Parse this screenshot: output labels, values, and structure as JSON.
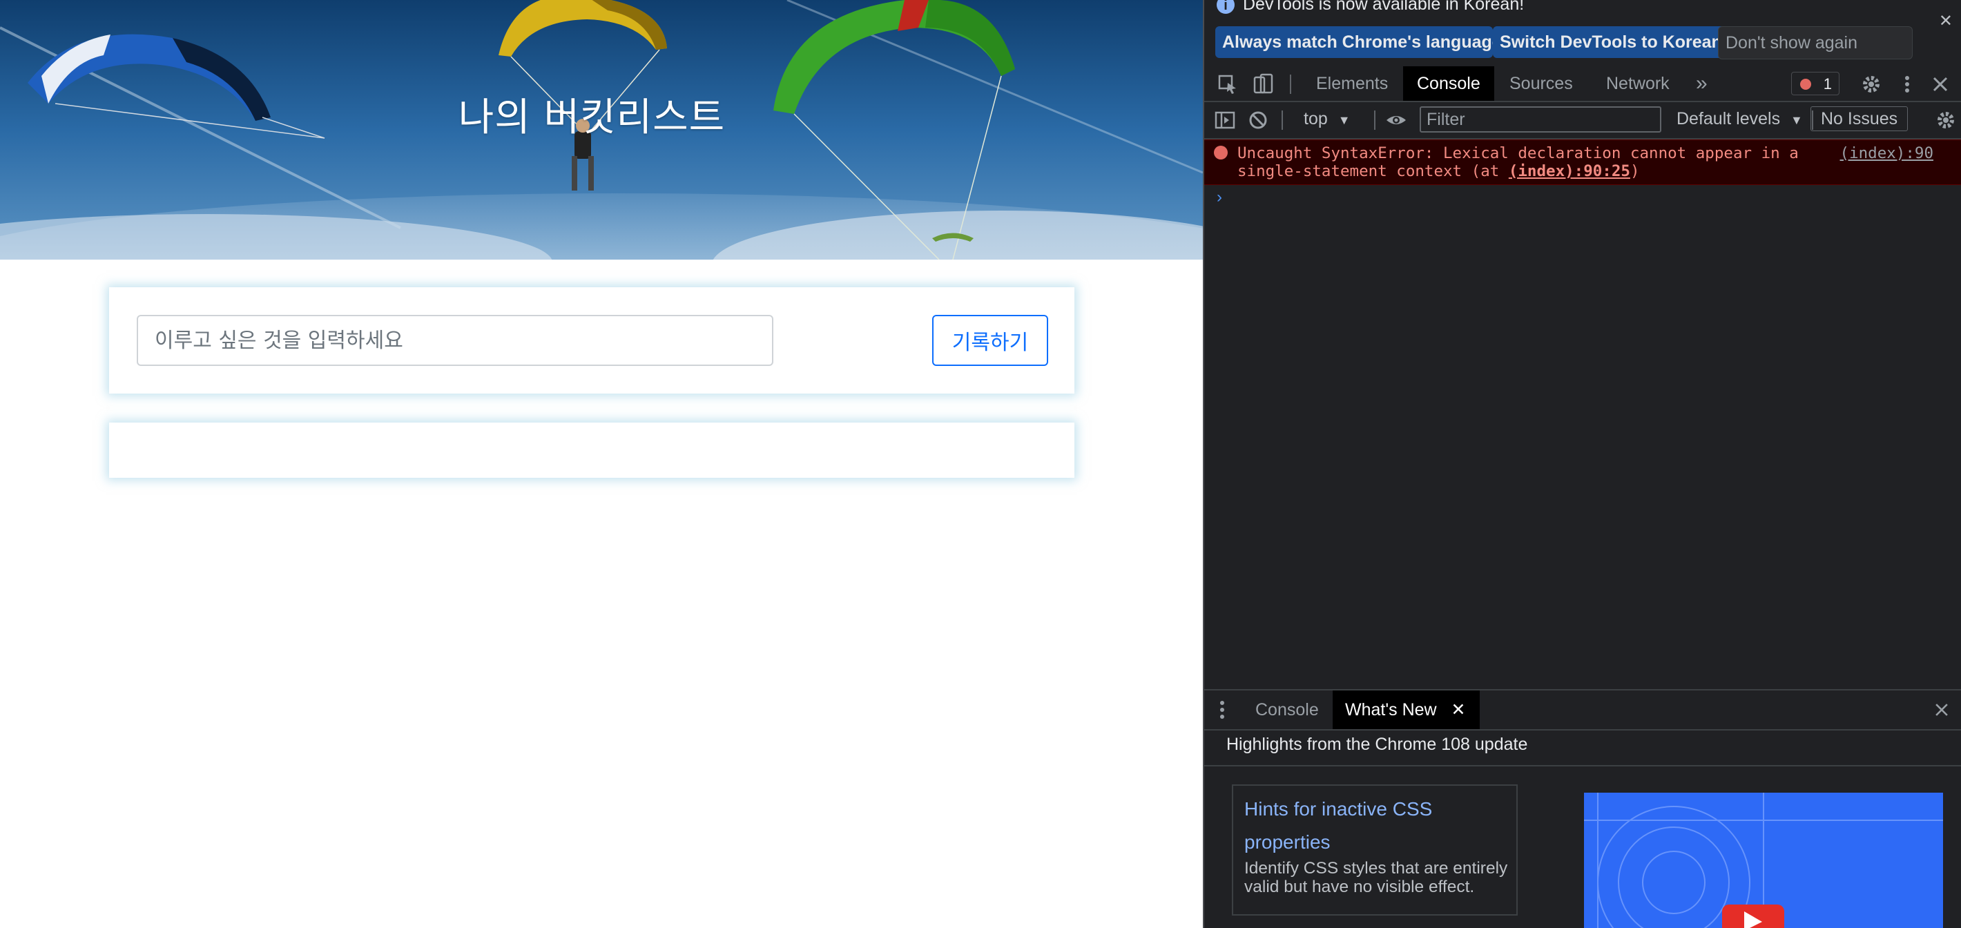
{
  "page": {
    "hero_title": "나의 버킷리스트",
    "goal_placeholder": "이루고 싶은 것을 입력하세요",
    "save_label": "기록하기"
  },
  "devtools": {
    "infobar": {
      "message": "DevTools is now available in Korean!",
      "btn_match": "Always match Chrome's language",
      "btn_switch": "Switch DevTools to Korean",
      "btn_dont": "Don't show again"
    },
    "tabs": [
      "Elements",
      "Console",
      "Sources",
      "Network"
    ],
    "overflow_glyph": "»",
    "error_count": "1",
    "toolbar": {
      "context": "top",
      "filter_placeholder": "Filter",
      "levels": "Default levels",
      "issues": "No Issues"
    },
    "console": {
      "error_line1": "Uncaught SyntaxError: Lexical declaration cannot appear in a",
      "error_line2_prefix": "single-statement context (at ",
      "error_link": "(index):90:25",
      "error_line2_suffix": ")",
      "error_source": "(index):90",
      "prompt_glyph": "›"
    },
    "drawer": {
      "tab_console": "Console",
      "tab_whats_new": "What's New",
      "heading": "Highlights from the Chrome 108 update",
      "card_title": "Hints for inactive CSS properties",
      "card_desc": "Identify CSS styles that are entirely valid but have no visible effect."
    }
  },
  "colors": {
    "accent_blue": "#0d6efd",
    "card_glow": "#98cde4",
    "devtools_bg": "#202124",
    "error_text": "#f28b82",
    "link_blue": "#8ab4f8"
  }
}
